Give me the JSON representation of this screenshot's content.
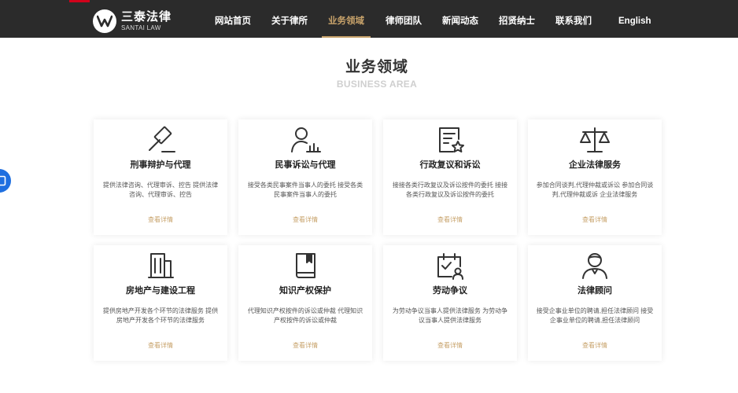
{
  "header": {
    "logo": {
      "cn": "三泰法律",
      "en": "SANTAI LAW"
    },
    "nav": [
      {
        "label": "网站首页",
        "active": false
      },
      {
        "label": "关于律所",
        "active": false
      },
      {
        "label": "业务领域",
        "active": true
      },
      {
        "label": "律师团队",
        "active": false
      },
      {
        "label": "新闻动态",
        "active": false
      },
      {
        "label": "招贤纳士",
        "active": false
      },
      {
        "label": "联系我们",
        "active": false
      },
      {
        "label": "English",
        "active": false
      }
    ]
  },
  "section": {
    "title": "业务领域",
    "subtitle": "BUSINESS AREA"
  },
  "cards": [
    {
      "icon": "gavel-icon",
      "title": "刑事辩护与代理",
      "desc": "提供法律咨询、代理审诉、控告 提供法律咨询、代理审诉、控告",
      "more": "查看详情"
    },
    {
      "icon": "person-chart-icon",
      "title": "民事诉讼与代理",
      "desc": "接受各类民事案件当事人的委托 接受各类民事案件当事人的委托",
      "more": "查看详情"
    },
    {
      "icon": "document-star-icon",
      "title": "行政复议和诉讼",
      "desc": "接接各类行政复议及诉讼按件的委托 接接各类行政复议及诉讼按件的委托",
      "more": "查看详情"
    },
    {
      "icon": "scales-icon",
      "title": "企业法律服务",
      "desc": "参加合同谈判,代理仲裁或诉讼 参加合同谈判,代理仲裁或诉 企业法律服务",
      "more": "查看详情"
    },
    {
      "icon": "building-icon",
      "title": "房地产与建设工程",
      "desc": "提供房地产开发各个环节的法律服务 提供房地产开发各个环节的法律服务",
      "more": "查看详情"
    },
    {
      "icon": "book-icon",
      "title": "知识产权保护",
      "desc": "代理知识产权按件的诉讼或仲裁 代理知识产权按件的诉讼或仲裁",
      "more": "查看详情"
    },
    {
      "icon": "calendar-person-icon",
      "title": "劳动争议",
      "desc": "为劳动争议当事人提供法律服务 为劳动争议当事人提供法律服务",
      "more": "查看详情"
    },
    {
      "icon": "advisor-icon",
      "title": "法律顾问",
      "desc": "接受企事业单位的聘请,担任法律顾问 接受企事业单位的聘请,担任法律顾问",
      "more": "查看详情"
    }
  ],
  "colors": {
    "accent": "#c7a26a",
    "topbar": "#2b2b2b",
    "float": "#1f6fe0"
  }
}
